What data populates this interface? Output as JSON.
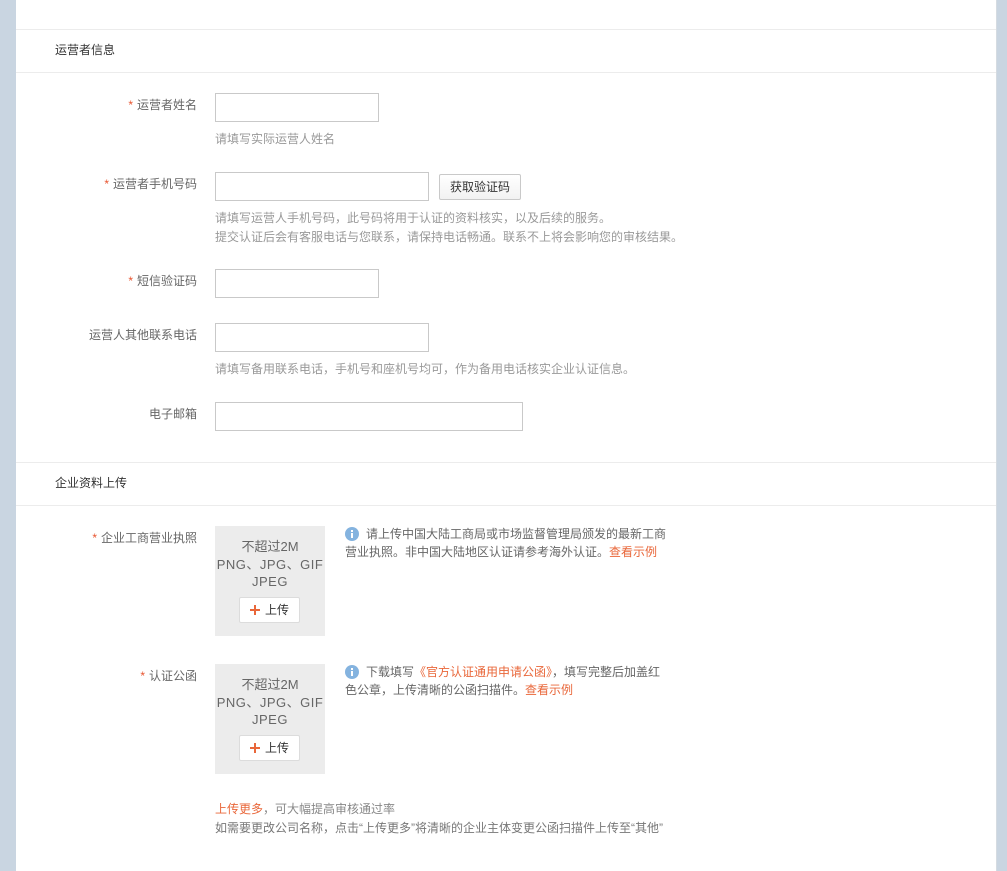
{
  "colors": {
    "accent": "#e9673a",
    "required": "#e8542f",
    "info_icon": "#84b3df",
    "page_background": "#c9d5e1",
    "panel_background": "#ffffff"
  },
  "operator_section": {
    "title": "运营者信息",
    "name": {
      "required_mark": "*",
      "label": "运营者姓名",
      "value": "",
      "hint": "请填写实际运营人姓名"
    },
    "phone": {
      "required_mark": "*",
      "label": "运营者手机号码",
      "value": "",
      "code_button": "获取验证码",
      "hints": [
        "请填写运营人手机号码，此号码将用于认证的资料核实，以及后续的服务。",
        "提交认证后会有客服电话与您联系，请保持电话畅通。联系不上将会影响您的审核结果。"
      ]
    },
    "sms_code": {
      "required_mark": "*",
      "label": "短信验证码",
      "value": ""
    },
    "other_phone": {
      "label": "运营人其他联系电话",
      "value": "",
      "hint": "请填写备用联系电话，手机号和座机号均可，作为备用电话核实企业认证信息。"
    },
    "email": {
      "label": "电子邮箱",
      "value": ""
    }
  },
  "upload_section": {
    "title": "企业资料上传",
    "business_license": {
      "required_mark": "*",
      "label": "企业工商营业执照",
      "upload_box": {
        "size_limit": "不超过2M",
        "formats": [
          "PNG、JPG、GIF",
          "JPEG"
        ],
        "button_icon": "plus-icon",
        "button_label": "上传"
      },
      "info_icon": "info-icon",
      "info": {
        "line1": "请上传中国大陆工商局或市场监督管理局颁发的最新工商",
        "line2": "营业执照。非中国大陆地区认证请参考海外认证。",
        "example_link": "查看示例"
      }
    },
    "certification_letter": {
      "required_mark": "*",
      "label": "认证公函",
      "upload_box": {
        "size_limit": "不超过2M",
        "formats": [
          "PNG、JPG、GIF",
          "JPEG"
        ],
        "button_icon": "plus-icon",
        "button_label": "上传"
      },
      "info_icon": "info-icon",
      "info": {
        "line1_before": "下载填写",
        "line1_link": "《官方认证通用申请公函》",
        "line1_after": "，填写完整后加盖红",
        "line2": "色公章，上传清晰的公函扫描件。",
        "example_link": "查看示例"
      }
    },
    "upload_more": {
      "link": "上传更多",
      "text": "，可大幅提高审核通过率",
      "note": "如需要更改公司名称，点击“上传更多”将清晰的企业主体变更公函扫描件上传至“其他”"
    }
  }
}
